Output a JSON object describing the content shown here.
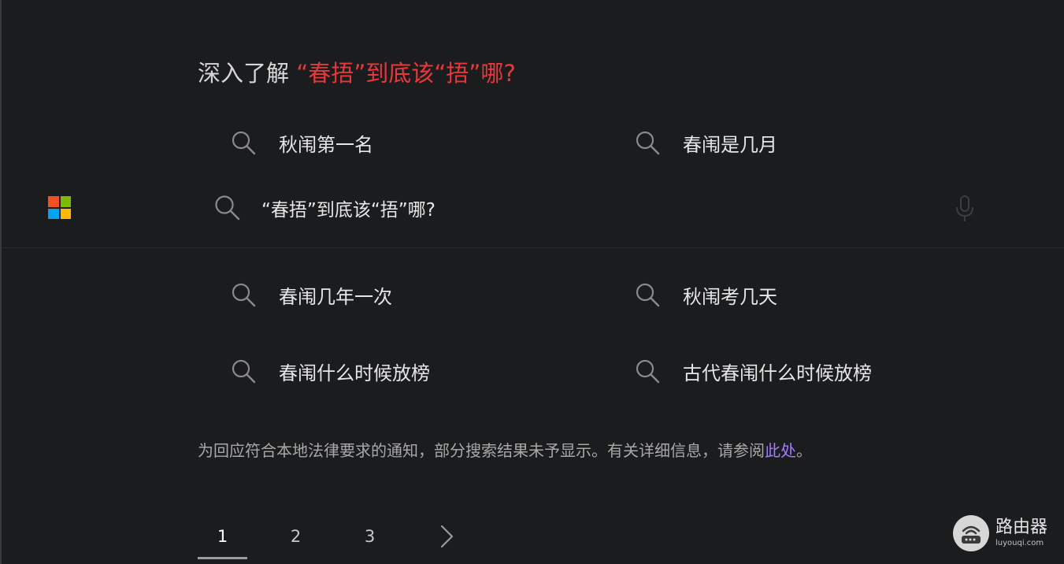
{
  "heading": {
    "prefix": "深入了解 ",
    "highlight": "“春捂”到底该“捂”哪?"
  },
  "search": {
    "query": "“春捂”到底该“捂”哪?"
  },
  "related_searches": [
    {
      "label": "秋闱第一名"
    },
    {
      "label": "春闱是几月"
    },
    {
      "label": "春闱几年一次"
    },
    {
      "label": "秋闱考几天"
    },
    {
      "label": "春闱什么时候放榜"
    },
    {
      "label": "古代春闱什么时候放榜"
    }
  ],
  "notice": {
    "text": "为回应符合本地法律要求的通知，部分搜索结果未予显示。有关详细信息，请参阅",
    "link": "此处",
    "suffix": "。"
  },
  "pagination": {
    "pages": [
      "1",
      "2",
      "3"
    ],
    "current": "1"
  },
  "watermark": {
    "name": "路由器",
    "url": "luyouqi.com"
  },
  "colors": {
    "background": "#1b1c1e",
    "heading_highlight": "#e8383a",
    "link": "#a57bff",
    "ms_red": "#f25022",
    "ms_green": "#7fba00",
    "ms_blue": "#00a4ef",
    "ms_yellow": "#ffb900"
  },
  "icons": [
    "search-icon",
    "microphone-icon",
    "microsoft-logo",
    "chevron-right-icon",
    "router-logo"
  ]
}
